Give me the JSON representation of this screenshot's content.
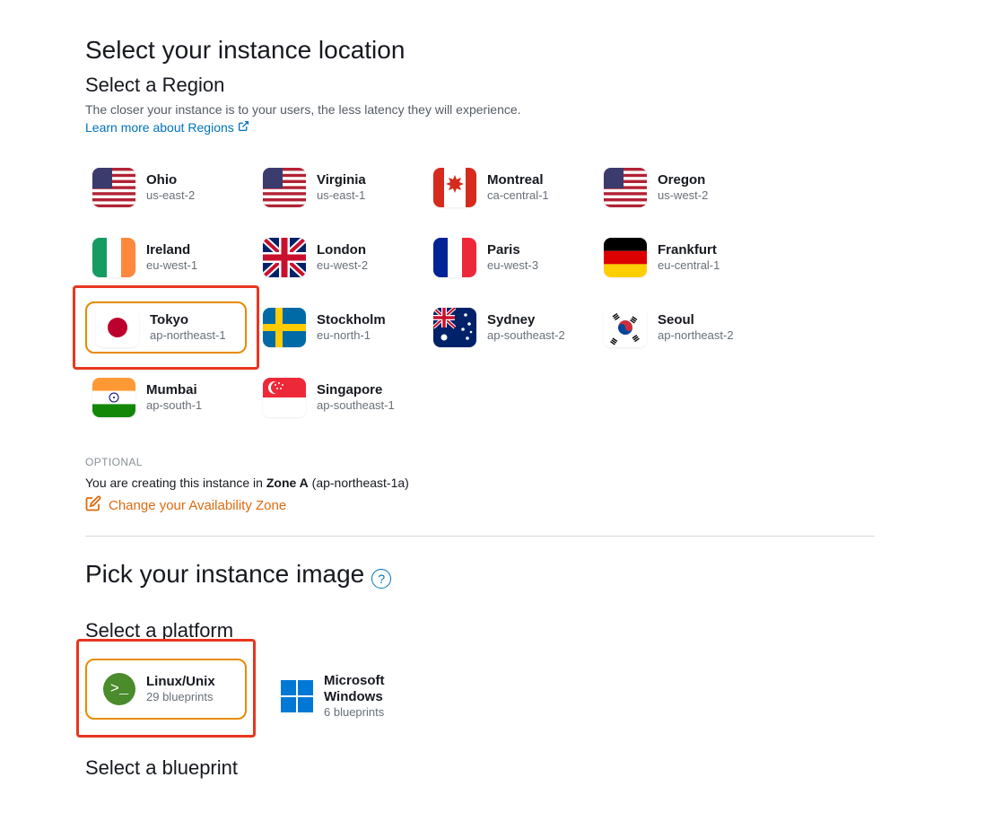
{
  "headings": {
    "location": "Select your instance location",
    "region": "Select a Region",
    "image": "Pick your instance image",
    "platform": "Select a platform",
    "blueprint": "Select a blueprint"
  },
  "desc": {
    "latency": "The closer your instance is to your users, the less latency they will experience.",
    "learn_more": "Learn more about Regions"
  },
  "regions": [
    {
      "name": "Ohio",
      "code": "us-east-2",
      "flag": "us"
    },
    {
      "name": "Virginia",
      "code": "us-east-1",
      "flag": "us"
    },
    {
      "name": "Montreal",
      "code": "ca-central-1",
      "flag": "ca"
    },
    {
      "name": "Oregon",
      "code": "us-west-2",
      "flag": "us"
    },
    {
      "name": "Ireland",
      "code": "eu-west-1",
      "flag": "ie"
    },
    {
      "name": "London",
      "code": "eu-west-2",
      "flag": "uk"
    },
    {
      "name": "Paris",
      "code": "eu-west-3",
      "flag": "fr"
    },
    {
      "name": "Frankfurt",
      "code": "eu-central-1",
      "flag": "de"
    },
    {
      "name": "Tokyo",
      "code": "ap-northeast-1",
      "flag": "jp",
      "selected": true,
      "highlight": true
    },
    {
      "name": "Stockholm",
      "code": "eu-north-1",
      "flag": "se"
    },
    {
      "name": "Sydney",
      "code": "ap-southeast-2",
      "flag": "au"
    },
    {
      "name": "Seoul",
      "code": "ap-northeast-2",
      "flag": "kr"
    },
    {
      "name": "Mumbai",
      "code": "ap-south-1",
      "flag": "in"
    },
    {
      "name": "Singapore",
      "code": "ap-southeast-1",
      "flag": "sg"
    }
  ],
  "optional": {
    "label": "OPTIONAL",
    "text_pre": "You are creating this instance in ",
    "zone_bold": "Zone A",
    "zone_paren": " (ap-northeast-1a)",
    "change": "Change your Availability Zone"
  },
  "platforms": [
    {
      "name": "Linux/Unix",
      "sub": "29 blueprints",
      "selected": true,
      "highlight": true,
      "type": "linux"
    },
    {
      "name": "Microsoft Windows",
      "sub": "6 blueprints",
      "type": "windows"
    }
  ]
}
